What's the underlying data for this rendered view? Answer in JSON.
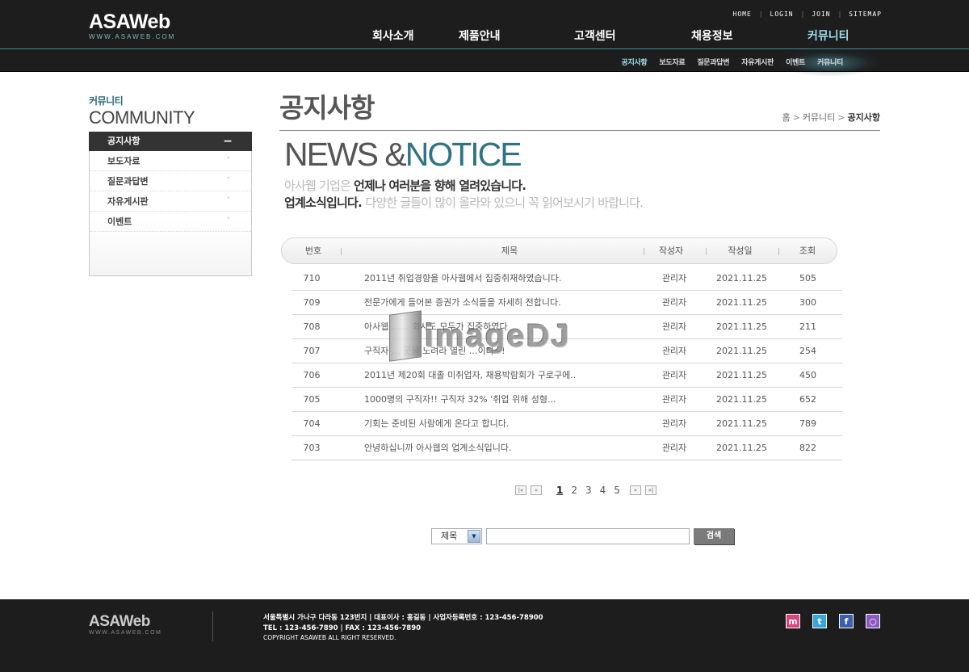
{
  "header": {
    "logo": {
      "name_a": "ASA",
      "name_b": "Web",
      "url": "WWW.ASAWEB.COM"
    },
    "util": [
      "HOME",
      "LOGIN",
      "JOIN",
      "SITEMAP"
    ],
    "gnb": [
      "회사소개",
      "제품안내",
      "고객센터",
      "채용정보",
      "커뮤니티"
    ],
    "lnb": [
      "공지사항",
      "보도자료",
      "질문과답변",
      "자유게시판",
      "이벤트",
      "커뮤니티"
    ]
  },
  "sidebar": {
    "title_ko": "커뮤니티",
    "title_en": "COMMUNITY",
    "items": [
      {
        "label": "공지사항",
        "ind": "−"
      },
      {
        "label": "보도자료",
        "ind": "˅"
      },
      {
        "label": "질문과답변",
        "ind": "˅"
      },
      {
        "label": "자유게시판",
        "ind": "˅"
      },
      {
        "label": "이벤트",
        "ind": "˅"
      }
    ]
  },
  "content": {
    "page_title": "공지사항",
    "breadcrumb": [
      "홈",
      "커뮤니티",
      "공지사항"
    ],
    "hero_a": "NEWS &",
    "hero_b": "NOTICE",
    "desc1_light": "아사웹 기업은 ",
    "desc1_dark": "언제나 여러분을 향해 열려있습니다.",
    "desc2_dark": "업계소식입니다. ",
    "desc2_light": "다양한 글들이 많이 올라와 있으니 꼭 읽어보시기 바랍니다."
  },
  "table": {
    "headers": [
      "번호",
      "제목",
      "작성자",
      "작성일",
      "조회"
    ],
    "rows": [
      {
        "num": "710",
        "subject": "2011년 취업경향을 아사웹에서 집중취재하였습니다.",
        "author": "관리자",
        "date": "2021.11.25",
        "hits": "505"
      },
      {
        "num": "709",
        "subject": "전문가에게 들어본 증권가 소식들을 자세히 전합니다.",
        "author": "관리자",
        "date": "2021.11.25",
        "hits": "300"
      },
      {
        "num": "708",
        "subject": "아사웹 …… 회사도 모두가 집중하였다",
        "author": "관리자",
        "date": "2021.11.25",
        "hits": "211"
      },
      {
        "num": "707",
        "subject": "구직자 … 곳을 노려라 열린 …이다~!",
        "author": "관리자",
        "date": "2021.11.25",
        "hits": "254"
      },
      {
        "num": "706",
        "subject": "2011년 제20회 대졸 미취업자, 채용박람회가 구로구에..",
        "author": "관리자",
        "date": "2021.11.25",
        "hits": "450"
      },
      {
        "num": "705",
        "subject": "1000명의 구직자!! 구직자 32% '취업 위해 성형...",
        "author": "관리자",
        "date": "2021.11.25",
        "hits": "652"
      },
      {
        "num": "704",
        "subject": "기회는 준비된 사람에게 온다고 합니다.",
        "author": "관리자",
        "date": "2021.11.25",
        "hits": "789"
      },
      {
        "num": "703",
        "subject": "안녕하십니까 아사웹의 업계소식입니다.",
        "author": "관리자",
        "date": "2021.11.25",
        "hits": "822"
      }
    ]
  },
  "watermark": "imageDJ",
  "paging": {
    "first": "|«",
    "prev": "«",
    "pages": [
      "1",
      "2",
      "3",
      "4",
      "5"
    ],
    "next": "»",
    "last": "»|"
  },
  "search": {
    "select": "제목",
    "dd": "▼",
    "input_value": "",
    "button": "검색"
  },
  "footer": {
    "logo_a": "ASA",
    "logo_b": "Web",
    "url": "WWW.ASAWEB.COM",
    "line1": "서울특별시 가나구 다라동 123번지  |  대표이사 : 홍길동  |  사업자등록번호 : 123-456-78900",
    "line2": "TEL : 123-456-7890  |  FAX : 123-456-7890",
    "line3": "COPYRIGHT ASAWEB ALL RIGHT RESERVED.",
    "sns": [
      {
        "label": "m",
        "color": "#d9457f"
      },
      {
        "label": "t",
        "color": "#3aa3d8"
      },
      {
        "label": "f",
        "color": "#3b5fa8"
      },
      {
        "label": "○",
        "color": "#8a5ac2"
      }
    ]
  }
}
